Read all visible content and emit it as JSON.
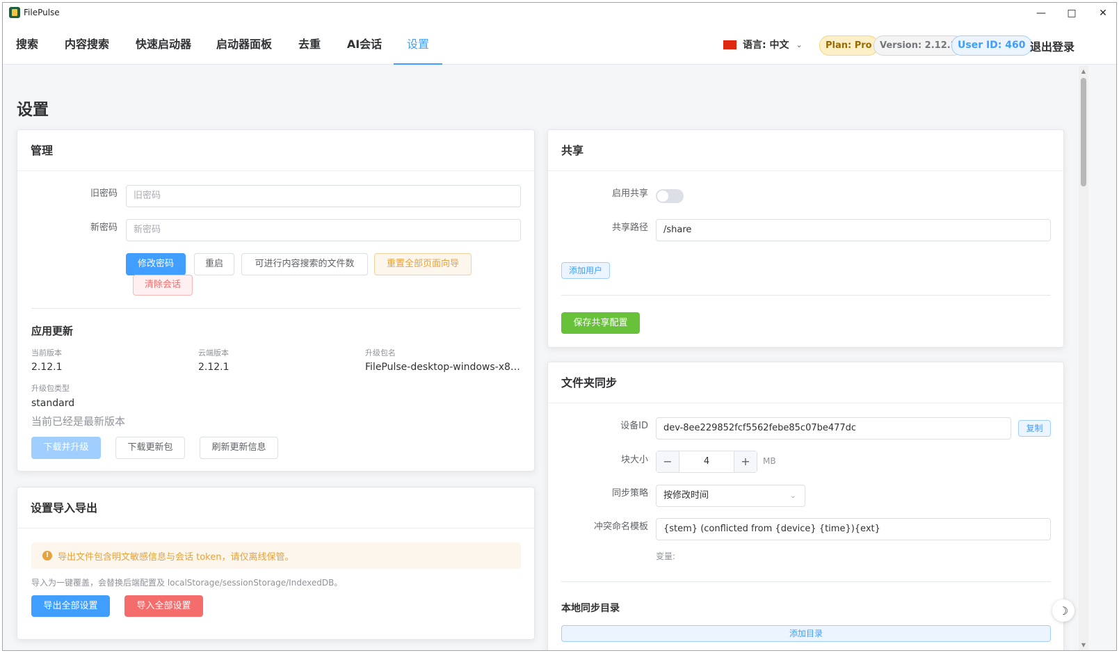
{
  "window": {
    "title": "FilePulse"
  },
  "nav": {
    "tabs": [
      "搜索",
      "内容搜索",
      "快速启动器",
      "启动器面板",
      "去重",
      "AI会话",
      "设置"
    ],
    "active_tab": "设置",
    "language_label": "语言: 中文",
    "plan": "Plan: Pro",
    "version": "Version: 2.12.1",
    "user_id": "User ID: 460",
    "logout": "退出登录"
  },
  "page": {
    "title": "设置"
  },
  "manage": {
    "title": "管理",
    "old_password_label": "旧密码",
    "old_password_placeholder": "旧密码",
    "new_password_label": "新密码",
    "new_password_placeholder": "新密码",
    "buttons": {
      "change_password": "修改密码",
      "restart": "重启",
      "content_search_files": "可进行内容搜索的文件数",
      "reset_guides": "重置全部页面向导",
      "clear_sessions": "清除会话"
    },
    "update": {
      "title": "应用更新",
      "current_version_label": "当前版本",
      "current_version": "2.12.1",
      "cloud_version_label": "云端版本",
      "cloud_version": "2.12.1",
      "package_name_label": "升级包名",
      "package_name": "FilePulse-desktop-windows-x86_...",
      "package_type_label": "升级包类型",
      "package_type": "standard",
      "status": "当前已经是最新版本",
      "buttons": {
        "download_upgrade": "下载并升级",
        "download_package": "下载更新包",
        "refresh_info": "刷新更新信息"
      }
    }
  },
  "import_export": {
    "title": "设置导入导出",
    "warning": "导出文件包含明文敏感信息与会话 token，请仅离线保管。",
    "note": "导入为一键覆盖，会替换后端配置及 localStorage/sessionStorage/IndexedDB。",
    "export_button": "导出全部设置",
    "import_button": "导入全部设置"
  },
  "share": {
    "title": "共享",
    "enable_label": "启用共享",
    "enabled": false,
    "path_label": "共享路径",
    "path_value": "/share",
    "add_user": "添加用户",
    "save": "保存共享配置"
  },
  "folder_sync": {
    "title": "文件夹同步",
    "device_id_label": "设备ID",
    "device_id": "dev-8ee229852fcf5562febe85c07be477dc",
    "copy": "复制",
    "chunk_size_label": "块大小",
    "chunk_size": "4",
    "chunk_unit": "MB",
    "strategy_label": "同步策略",
    "strategy": "按修改时间",
    "conflict_label": "冲突命名模板",
    "conflict_template": "{stem} (conflicted from {device} {time}){ext}",
    "variables_label": "变量:",
    "local_dirs_title": "本地同步目录",
    "add_dir": "添加目录"
  },
  "colors": {
    "primary": "#409eff",
    "success": "#67c23a",
    "warning": "#e6a23c",
    "danger": "#f56c6c"
  },
  "icons": {
    "theme_toggle": "moon-icon",
    "flag": "china-flag-icon"
  }
}
